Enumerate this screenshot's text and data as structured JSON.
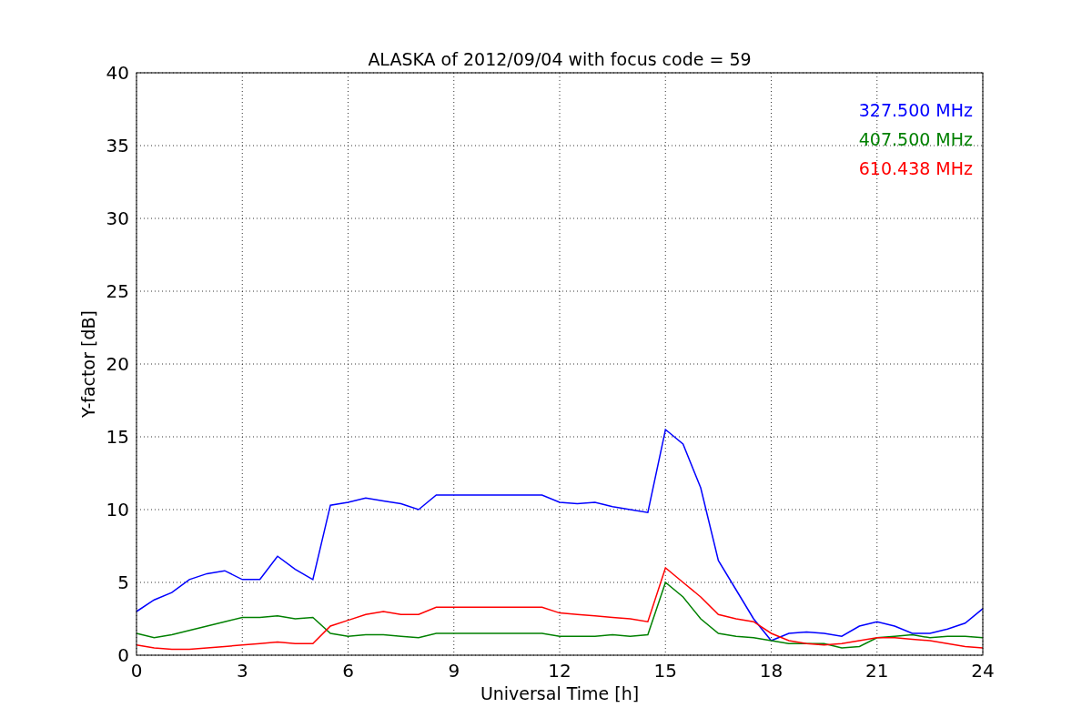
{
  "figure": {
    "chart_data": {
      "type": "line",
      "title": "ALASKA of 2012/09/04 with focus code = 59",
      "xlabel": "Universal Time [h]",
      "ylabel": "Y-factor [dB]",
      "x": [
        0,
        0.5,
        1,
        1.5,
        2,
        2.5,
        3,
        3.5,
        4,
        4.5,
        5,
        5.5,
        6,
        6.5,
        7,
        7.5,
        8,
        8.5,
        9,
        9.5,
        10,
        10.5,
        11,
        11.5,
        12,
        12.5,
        13,
        13.5,
        14,
        14.5,
        15,
        15.5,
        16,
        16.5,
        17,
        17.5,
        18,
        18.5,
        19,
        19.5,
        20,
        20.5,
        21,
        21.5,
        22,
        22.5,
        23,
        23.5,
        24
      ],
      "series": [
        {
          "name": "327.500 MHz",
          "color": "#0000ff",
          "values": [
            3,
            3.8,
            4.3,
            5.2,
            5.6,
            5.8,
            5.2,
            5.2,
            6.8,
            5.9,
            5.2,
            10.3,
            10.5,
            10.8,
            10.6,
            10.4,
            10,
            11,
            11,
            11,
            11,
            11,
            11,
            11,
            10.5,
            10.4,
            10.5,
            10.2,
            10,
            9.8,
            15.5,
            14.5,
            11.5,
            6.5,
            4.5,
            2.5,
            1,
            1.5,
            1.6,
            1.5,
            1.3,
            2,
            2.3,
            2,
            1.5,
            1.5,
            1.8,
            2.2,
            3.2
          ]
        },
        {
          "name": "407.500 MHz",
          "color": "#008000",
          "values": [
            1.5,
            1.2,
            1.4,
            1.7,
            2,
            2.3,
            2.6,
            2.6,
            2.7,
            2.5,
            2.6,
            1.5,
            1.3,
            1.4,
            1.4,
            1.3,
            1.2,
            1.5,
            1.5,
            1.5,
            1.5,
            1.5,
            1.5,
            1.5,
            1.3,
            1.3,
            1.3,
            1.4,
            1.3,
            1.4,
            5,
            4,
            2.5,
            1.5,
            1.3,
            1.2,
            1,
            0.8,
            0.8,
            0.8,
            0.5,
            0.6,
            1.2,
            1.3,
            1.4,
            1.2,
            1.3,
            1.3,
            1.2
          ]
        },
        {
          "name": "610.438 MHz",
          "color": "#ff0000",
          "values": [
            0.7,
            0.5,
            0.4,
            0.4,
            0.5,
            0.6,
            0.7,
            0.8,
            0.9,
            0.8,
            0.8,
            2,
            2.4,
            2.8,
            3,
            2.8,
            2.8,
            3.3,
            3.3,
            3.3,
            3.3,
            3.3,
            3.3,
            3.3,
            2.9,
            2.8,
            2.7,
            2.6,
            2.5,
            2.3,
            6,
            5,
            4,
            2.8,
            2.5,
            2.3,
            1.5,
            1,
            0.8,
            0.7,
            0.8,
            1,
            1.2,
            1.2,
            1.1,
            1,
            0.8,
            0.6,
            0.5
          ]
        }
      ],
      "xlim": [
        0,
        24
      ],
      "ylim": [
        0,
        40
      ],
      "xticks": [
        0,
        3,
        6,
        9,
        12,
        15,
        18,
        21,
        24
      ],
      "yticks": [
        0,
        5,
        10,
        15,
        20,
        25,
        30,
        35,
        40
      ],
      "grid": true
    }
  }
}
